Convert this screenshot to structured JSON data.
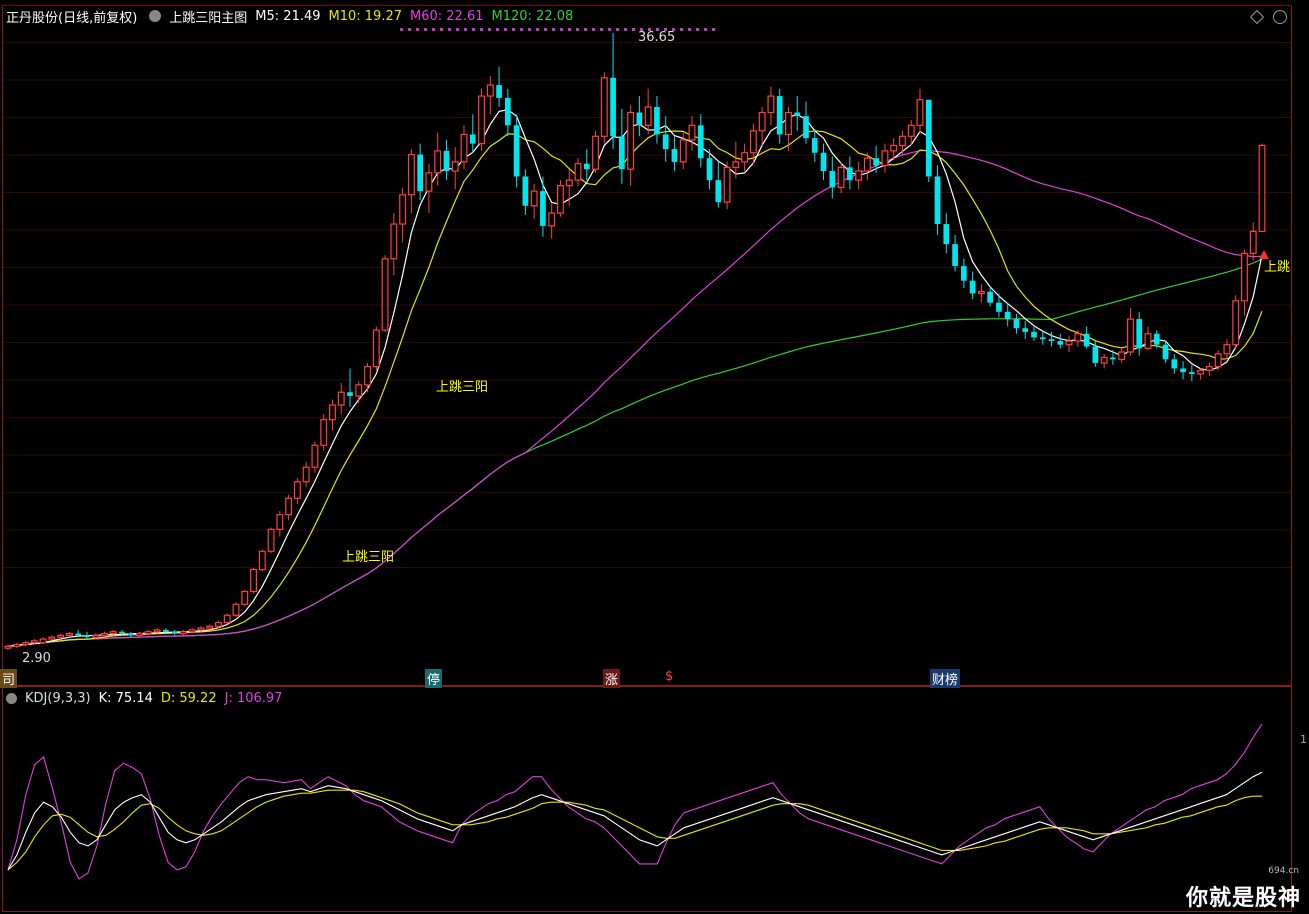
{
  "header": {
    "stock": "正丹股份(日线,前复权)",
    "indicator": "上跳三阳主图",
    "ma": [
      {
        "label": "M5: 21.49",
        "color": "#ffffff"
      },
      {
        "label": "M10: 19.27",
        "color": "#e6e600"
      },
      {
        "label": "M60: 22.61",
        "color": "#e040e0"
      },
      {
        "label": "M120: 22.08",
        "color": "#30d030"
      }
    ]
  },
  "kdj_header": {
    "name": "KDJ(9,3,3)",
    "k": "K: 75.14",
    "d": "D: 59.22",
    "j": "J: 106.97",
    "k_color": "#ffffff",
    "d_color": "#e6e600",
    "j_color": "#e040e0"
  },
  "annotations": {
    "high_label": "36.65",
    "low_label": "2.90",
    "signal_1": "上跳三阳",
    "signal_2": "上跳三阳",
    "signal_3": "上跳",
    "event_1": "停",
    "event_2": "涨",
    "event_3": "$",
    "event_4": "财榜",
    "edge": "司",
    "kdj_scale": "1"
  },
  "watermark": {
    "text": "你就是股神",
    "site": "694.cn"
  },
  "colors": {
    "up": "#ff4040",
    "down": "#00e5ee",
    "panel_border": "#8b1a1a",
    "signal": "#ffff00"
  },
  "chart_data": {
    "type": "candlestick",
    "ylim": [
      2.9,
      36.65
    ],
    "candles": [
      [
        3.0,
        3.2,
        2.9,
        3.1
      ],
      [
        3.1,
        3.3,
        3.0,
        3.2
      ],
      [
        3.2,
        3.4,
        3.1,
        3.3
      ],
      [
        3.3,
        3.5,
        3.2,
        3.4
      ],
      [
        3.3,
        3.6,
        3.2,
        3.5
      ],
      [
        3.5,
        3.7,
        3.4,
        3.6
      ],
      [
        3.6,
        3.8,
        3.5,
        3.7
      ],
      [
        3.7,
        3.9,
        3.6,
        3.8
      ],
      [
        3.8,
        4.0,
        3.6,
        3.7
      ],
      [
        3.7,
        3.9,
        3.5,
        3.6
      ],
      [
        3.6,
        3.8,
        3.5,
        3.7
      ],
      [
        3.7,
        3.9,
        3.6,
        3.8
      ],
      [
        3.8,
        4.0,
        3.7,
        3.9
      ],
      [
        3.9,
        4.0,
        3.7,
        3.8
      ],
      [
        3.8,
        3.9,
        3.6,
        3.7
      ],
      [
        3.7,
        3.9,
        3.6,
        3.8
      ],
      [
        3.8,
        4.0,
        3.7,
        3.9
      ],
      [
        3.9,
        4.1,
        3.8,
        4.0
      ],
      [
        4.0,
        4.1,
        3.8,
        3.9
      ],
      [
        3.9,
        4.0,
        3.7,
        3.8
      ],
      [
        3.8,
        4.0,
        3.7,
        3.9
      ],
      [
        3.9,
        4.1,
        3.8,
        4.0
      ],
      [
        4.0,
        4.2,
        3.9,
        4.1
      ],
      [
        4.1,
        4.3,
        4.0,
        4.2
      ],
      [
        4.2,
        4.5,
        4.1,
        4.4
      ],
      [
        4.4,
        4.9,
        4.3,
        4.8
      ],
      [
        4.8,
        5.5,
        4.7,
        5.4
      ],
      [
        5.4,
        6.2,
        5.3,
        6.1
      ],
      [
        6.1,
        7.4,
        6.0,
        7.3
      ],
      [
        7.3,
        8.4,
        7.2,
        8.3
      ],
      [
        8.3,
        9.6,
        8.2,
        9.5
      ],
      [
        9.5,
        10.5,
        9.1,
        10.3
      ],
      [
        10.3,
        11.4,
        10.0,
        11.2
      ],
      [
        11.2,
        12.3,
        10.9,
        12.1
      ],
      [
        12.1,
        13.2,
        11.8,
        12.9
      ],
      [
        12.9,
        14.3,
        12.6,
        14.1
      ],
      [
        14.1,
        15.8,
        13.8,
        15.5
      ],
      [
        15.5,
        16.6,
        14.9,
        16.3
      ],
      [
        16.3,
        17.5,
        15.8,
        17.0
      ],
      [
        17.0,
        18.3,
        16.2,
        16.8
      ],
      [
        16.8,
        17.6,
        16.4,
        17.4
      ],
      [
        17.4,
        18.6,
        17.0,
        18.4
      ],
      [
        18.4,
        20.6,
        18.2,
        20.4
      ],
      [
        20.4,
        24.5,
        20.3,
        24.3
      ],
      [
        24.3,
        26.8,
        23.4,
        26.2
      ],
      [
        26.2,
        28.2,
        25.2,
        27.8
      ],
      [
        27.8,
        30.3,
        26.8,
        30.0
      ],
      [
        30.0,
        30.6,
        27.5,
        28.0
      ],
      [
        28.0,
        29.5,
        26.8,
        29.0
      ],
      [
        29.0,
        31.2,
        28.3,
        30.2
      ],
      [
        30.2,
        30.8,
        28.6,
        29.1
      ],
      [
        29.1,
        30.4,
        28.1,
        29.6
      ],
      [
        29.6,
        31.6,
        29.2,
        31.1
      ],
      [
        31.1,
        32.2,
        30.1,
        30.6
      ],
      [
        30.6,
        33.6,
        30.2,
        33.2
      ],
      [
        33.2,
        34.3,
        32.2,
        33.8
      ],
      [
        33.8,
        34.8,
        32.6,
        33.1
      ],
      [
        33.1,
        33.6,
        31.0,
        31.6
      ],
      [
        31.6,
        32.2,
        28.2,
        28.8
      ],
      [
        28.8,
        29.2,
        26.7,
        27.2
      ],
      [
        27.2,
        28.4,
        26.5,
        28.0
      ],
      [
        28.0,
        28.8,
        25.5,
        26.1
      ],
      [
        26.1,
        27.3,
        25.4,
        26.8
      ],
      [
        26.8,
        28.6,
        26.6,
        28.3
      ],
      [
        28.3,
        29.2,
        27.2,
        28.6
      ],
      [
        28.6,
        29.8,
        28.3,
        29.5
      ],
      [
        29.5,
        30.3,
        28.6,
        29.2
      ],
      [
        29.2,
        31.3,
        29.0,
        31.0
      ],
      [
        31.0,
        34.5,
        30.6,
        34.2
      ],
      [
        34.2,
        36.65,
        30.3,
        31.0
      ],
      [
        31.0,
        32.5,
        28.4,
        29.2
      ],
      [
        29.2,
        32.7,
        28.3,
        32.3
      ],
      [
        32.3,
        33.2,
        31.0,
        31.6
      ],
      [
        31.6,
        33.6,
        31.1,
        32.6
      ],
      [
        32.6,
        33.2,
        30.6,
        31.1
      ],
      [
        31.1,
        32.1,
        29.6,
        30.3
      ],
      [
        30.3,
        31.0,
        29.1,
        29.6
      ],
      [
        29.6,
        31.2,
        29.2,
        30.8
      ],
      [
        30.8,
        32.1,
        30.2,
        31.6
      ],
      [
        31.6,
        32.2,
        29.3,
        29.8
      ],
      [
        29.8,
        30.3,
        28.1,
        28.6
      ],
      [
        28.6,
        29.6,
        27.1,
        27.4
      ],
      [
        27.4,
        29.6,
        27.0,
        29.3
      ],
      [
        29.3,
        30.7,
        28.7,
        29.6
      ],
      [
        29.6,
        30.6,
        29.1,
        30.1
      ],
      [
        30.1,
        31.7,
        29.5,
        31.3
      ],
      [
        31.3,
        32.6,
        30.5,
        32.3
      ],
      [
        32.3,
        33.7,
        31.6,
        33.2
      ],
      [
        33.2,
        33.6,
        30.6,
        31.1
      ],
      [
        31.1,
        32.6,
        30.2,
        32.3
      ],
      [
        32.3,
        33.2,
        31.3,
        32.1
      ],
      [
        32.1,
        32.9,
        30.6,
        30.9
      ],
      [
        30.9,
        31.4,
        29.6,
        30.1
      ],
      [
        30.1,
        30.6,
        28.6,
        29.1
      ],
      [
        29.1,
        29.9,
        27.6,
        28.2
      ],
      [
        28.2,
        29.6,
        27.9,
        29.3
      ],
      [
        29.3,
        29.9,
        28.1,
        28.6
      ],
      [
        28.6,
        29.6,
        28.1,
        29.1
      ],
      [
        29.1,
        30.1,
        28.6,
        29.8
      ],
      [
        29.8,
        30.5,
        29.0,
        29.4
      ],
      [
        29.4,
        30.6,
        29.0,
        30.2
      ],
      [
        30.2,
        30.9,
        29.7,
        30.5
      ],
      [
        30.5,
        31.3,
        30.0,
        31.0
      ],
      [
        31.0,
        31.9,
        30.5,
        31.6
      ],
      [
        31.6,
        33.6,
        31.2,
        33.0
      ],
      [
        33.0,
        32.5,
        28.5,
        28.8
      ],
      [
        28.8,
        29.4,
        25.6,
        26.2
      ],
      [
        26.2,
        26.8,
        24.6,
        25.1
      ],
      [
        25.1,
        25.6,
        23.6,
        23.9
      ],
      [
        23.9,
        24.3,
        22.7,
        23.1
      ],
      [
        23.1,
        23.6,
        22.1,
        22.4
      ],
      [
        22.4,
        22.9,
        21.9,
        22.5
      ],
      [
        22.5,
        22.8,
        21.7,
        21.9
      ],
      [
        21.9,
        22.4,
        21.1,
        21.4
      ],
      [
        21.4,
        21.9,
        20.6,
        21.0
      ],
      [
        21.0,
        21.3,
        20.2,
        20.5
      ],
      [
        20.5,
        20.9,
        19.9,
        20.3
      ],
      [
        20.3,
        20.7,
        19.8,
        20.0
      ],
      [
        20.0,
        20.4,
        19.6,
        19.9
      ],
      [
        19.9,
        20.3,
        19.5,
        19.8
      ],
      [
        19.8,
        20.2,
        19.4,
        19.6
      ],
      [
        19.6,
        20.1,
        19.2,
        19.8
      ],
      [
        19.8,
        20.4,
        19.5,
        20.2
      ],
      [
        20.2,
        20.6,
        19.4,
        19.5
      ],
      [
        19.5,
        19.8,
        18.4,
        18.6
      ],
      [
        18.6,
        19.1,
        18.3,
        18.9
      ],
      [
        18.9,
        19.3,
        18.5,
        18.8
      ],
      [
        18.8,
        19.4,
        18.6,
        19.2
      ],
      [
        19.2,
        21.6,
        19.0,
        21.0
      ],
      [
        21.0,
        21.4,
        19.0,
        19.4
      ],
      [
        19.4,
        20.6,
        19.3,
        20.2
      ],
      [
        20.2,
        20.4,
        19.4,
        19.6
      ],
      [
        19.6,
        19.8,
        18.6,
        18.8
      ],
      [
        18.8,
        19.1,
        18.0,
        18.3
      ],
      [
        18.3,
        18.7,
        17.7,
        18.1
      ],
      [
        18.1,
        18.5,
        17.6,
        18.0
      ],
      [
        18.0,
        18.3,
        17.7,
        18.2
      ],
      [
        18.2,
        18.6,
        17.9,
        18.4
      ],
      [
        18.4,
        19.3,
        18.2,
        19.1
      ],
      [
        19.1,
        19.9,
        18.8,
        19.6
      ],
      [
        19.6,
        22.3,
        19.4,
        22.0
      ],
      [
        22.0,
        24.8,
        21.2,
        24.6
      ],
      [
        24.6,
        26.3,
        24.2,
        25.8
      ],
      [
        25.8,
        30.6,
        25.8,
        30.5
      ]
    ],
    "kdj": {
      "k": [
        10,
        20,
        35,
        48,
        55,
        52,
        45,
        35,
        28,
        26,
        30,
        40,
        50,
        55,
        58,
        60,
        55,
        45,
        35,
        30,
        28,
        30,
        34,
        38,
        42,
        47,
        52,
        56,
        58,
        60,
        61,
        62,
        63,
        64,
        62,
        64,
        66,
        65,
        64,
        62,
        60,
        58,
        56,
        53,
        50,
        47,
        44,
        42,
        40,
        38,
        36,
        40,
        42,
        44,
        46,
        48,
        50,
        52,
        55,
        58,
        60,
        58,
        56,
        54,
        52,
        50,
        48,
        46,
        42,
        38,
        34,
        30,
        28,
        26,
        30,
        34,
        38,
        40,
        42,
        44,
        46,
        48,
        50,
        52,
        54,
        56,
        58,
        56,
        54,
        52,
        50,
        48,
        46,
        44,
        42,
        40,
        38,
        36,
        34,
        32,
        30,
        28,
        26,
        24,
        22,
        20,
        22,
        24,
        26,
        28,
        30,
        32,
        34,
        36,
        38,
        40,
        42,
        40,
        38,
        36,
        34,
        32,
        30,
        32,
        34,
        36,
        38,
        40,
        42,
        44,
        46,
        48,
        50,
        52,
        54,
        56,
        58,
        60,
        64,
        68,
        72,
        75
      ],
      "d": [
        10,
        15,
        22,
        32,
        40,
        46,
        47,
        45,
        40,
        35,
        32,
        33,
        37,
        42,
        48,
        53,
        54,
        51,
        45,
        40,
        36,
        34,
        33,
        34,
        36,
        40,
        44,
        48,
        52,
        55,
        57,
        59,
        60,
        61,
        61,
        62,
        63,
        63,
        63,
        63,
        62,
        60,
        58,
        56,
        54,
        51,
        48,
        46,
        44,
        42,
        40,
        40,
        40,
        41,
        42,
        44,
        45,
        47,
        49,
        51,
        54,
        55,
        55,
        55,
        54,
        53,
        51,
        50,
        47,
        44,
        41,
        38,
        35,
        32,
        31,
        31,
        33,
        35,
        37,
        39,
        41,
        43,
        45,
        47,
        49,
        51,
        53,
        54,
        54,
        54,
        53,
        51,
        49,
        47,
        45,
        43,
        41,
        39,
        37,
        35,
        33,
        31,
        29,
        27,
        25,
        23,
        23,
        23,
        24,
        25,
        26,
        28,
        29,
        31,
        33,
        35,
        37,
        38,
        38,
        38,
        37,
        36,
        34,
        34,
        34,
        35,
        36,
        37,
        38,
        40,
        41,
        43,
        45,
        46,
        48,
        50,
        52,
        53,
        56,
        58,
        59,
        59
      ],
      "j": [
        10,
        30,
        60,
        80,
        85,
        64,
        41,
        15,
        4,
        8,
        26,
        54,
        76,
        81,
        78,
        74,
        57,
        33,
        15,
        10,
        12,
        22,
        36,
        46,
        54,
        61,
        68,
        72,
        70,
        70,
        69,
        68,
        69,
        70,
        64,
        68,
        72,
        69,
        66,
        60,
        56,
        54,
        52,
        47,
        42,
        39,
        36,
        34,
        32,
        30,
        28,
        40,
        46,
        50,
        54,
        56,
        60,
        62,
        67,
        72,
        72,
        64,
        58,
        52,
        48,
        44,
        42,
        38,
        32,
        26,
        20,
        14,
        14,
        14,
        28,
        40,
        48,
        50,
        52,
        54,
        56,
        58,
        60,
        62,
        64,
        66,
        68,
        60,
        54,
        48,
        44,
        42,
        40,
        38,
        36,
        34,
        32,
        30,
        28,
        26,
        24,
        22,
        20,
        18,
        16,
        14,
        20,
        26,
        30,
        34,
        38,
        40,
        44,
        46,
        48,
        50,
        52,
        44,
        38,
        32,
        28,
        24,
        22,
        28,
        34,
        38,
        42,
        46,
        50,
        52,
        56,
        58,
        60,
        64,
        66,
        68,
        70,
        74,
        80,
        88,
        98,
        107
      ]
    }
  }
}
